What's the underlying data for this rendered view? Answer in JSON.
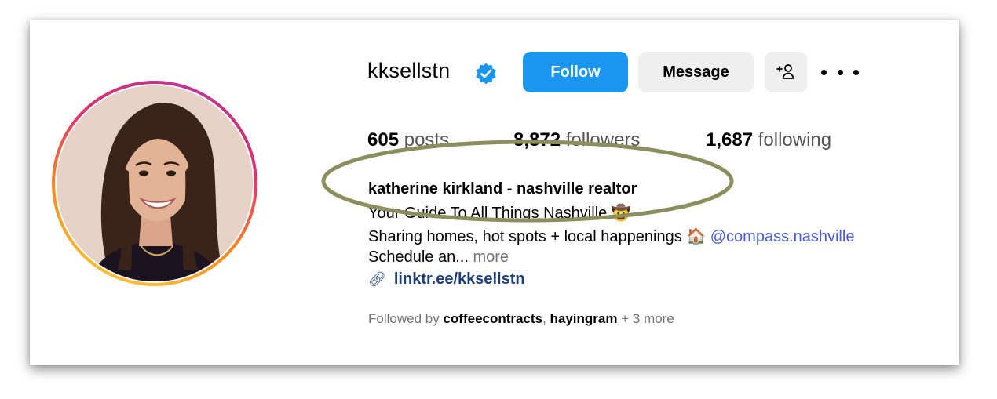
{
  "profile": {
    "username": "kksellstn",
    "verified": true,
    "avatar_alt": "profile-photo"
  },
  "actions": {
    "follow_label": "Follow",
    "message_label": "Message",
    "add_user_icon": "+person-icon",
    "more_icon": "ellipsis-icon"
  },
  "stats": {
    "posts_count": "605",
    "posts_label": "posts",
    "followers_count": "8,872",
    "followers_label": "followers",
    "following_count": "1,687",
    "following_label": "following"
  },
  "bio": {
    "full_name": "katherine kirkland - nashville realtor",
    "line1": "Your Guide To All Things Nashville 🤠",
    "line2_text": "Sharing homes, hot spots + local happenings 🏠 ",
    "line2_mention": "@compass.nashville",
    "line3_text": "Schedule an...",
    "line3_more": "more",
    "link": "linktr.ee/kksellstn"
  },
  "followed_by": {
    "prefix": "Followed by",
    "user1": "coffeecontracts",
    "user2": "hayingram",
    "suffix": "+ 3 more"
  },
  "colors": {
    "follow_button": "#1a95f0",
    "secondary_button": "#efefef",
    "verified_badge": "#1a95f0",
    "annotation_ellipse": "#8a8f5e",
    "mention": "#4a5cd6"
  }
}
